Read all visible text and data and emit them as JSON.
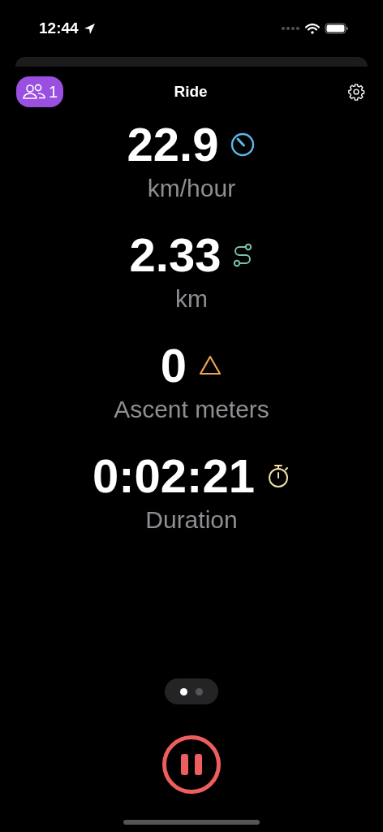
{
  "status_bar": {
    "time": "12:44"
  },
  "header": {
    "group_count": "1",
    "title": "Ride"
  },
  "metrics": [
    {
      "value": "22.9",
      "label": "km/hour",
      "kind": "speed",
      "color": "#5ab8e8"
    },
    {
      "value": "2.33",
      "label": "km",
      "kind": "route",
      "color": "#7cc4a8"
    },
    {
      "value": "0",
      "label": "Ascent meters",
      "kind": "ascent",
      "color": "#e8a550"
    },
    {
      "value": "0:02:21",
      "label": "Duration",
      "kind": "timer",
      "color": "#efe0a8"
    }
  ],
  "pages": [
    {
      "selected": true
    },
    {
      "selected": false
    }
  ]
}
